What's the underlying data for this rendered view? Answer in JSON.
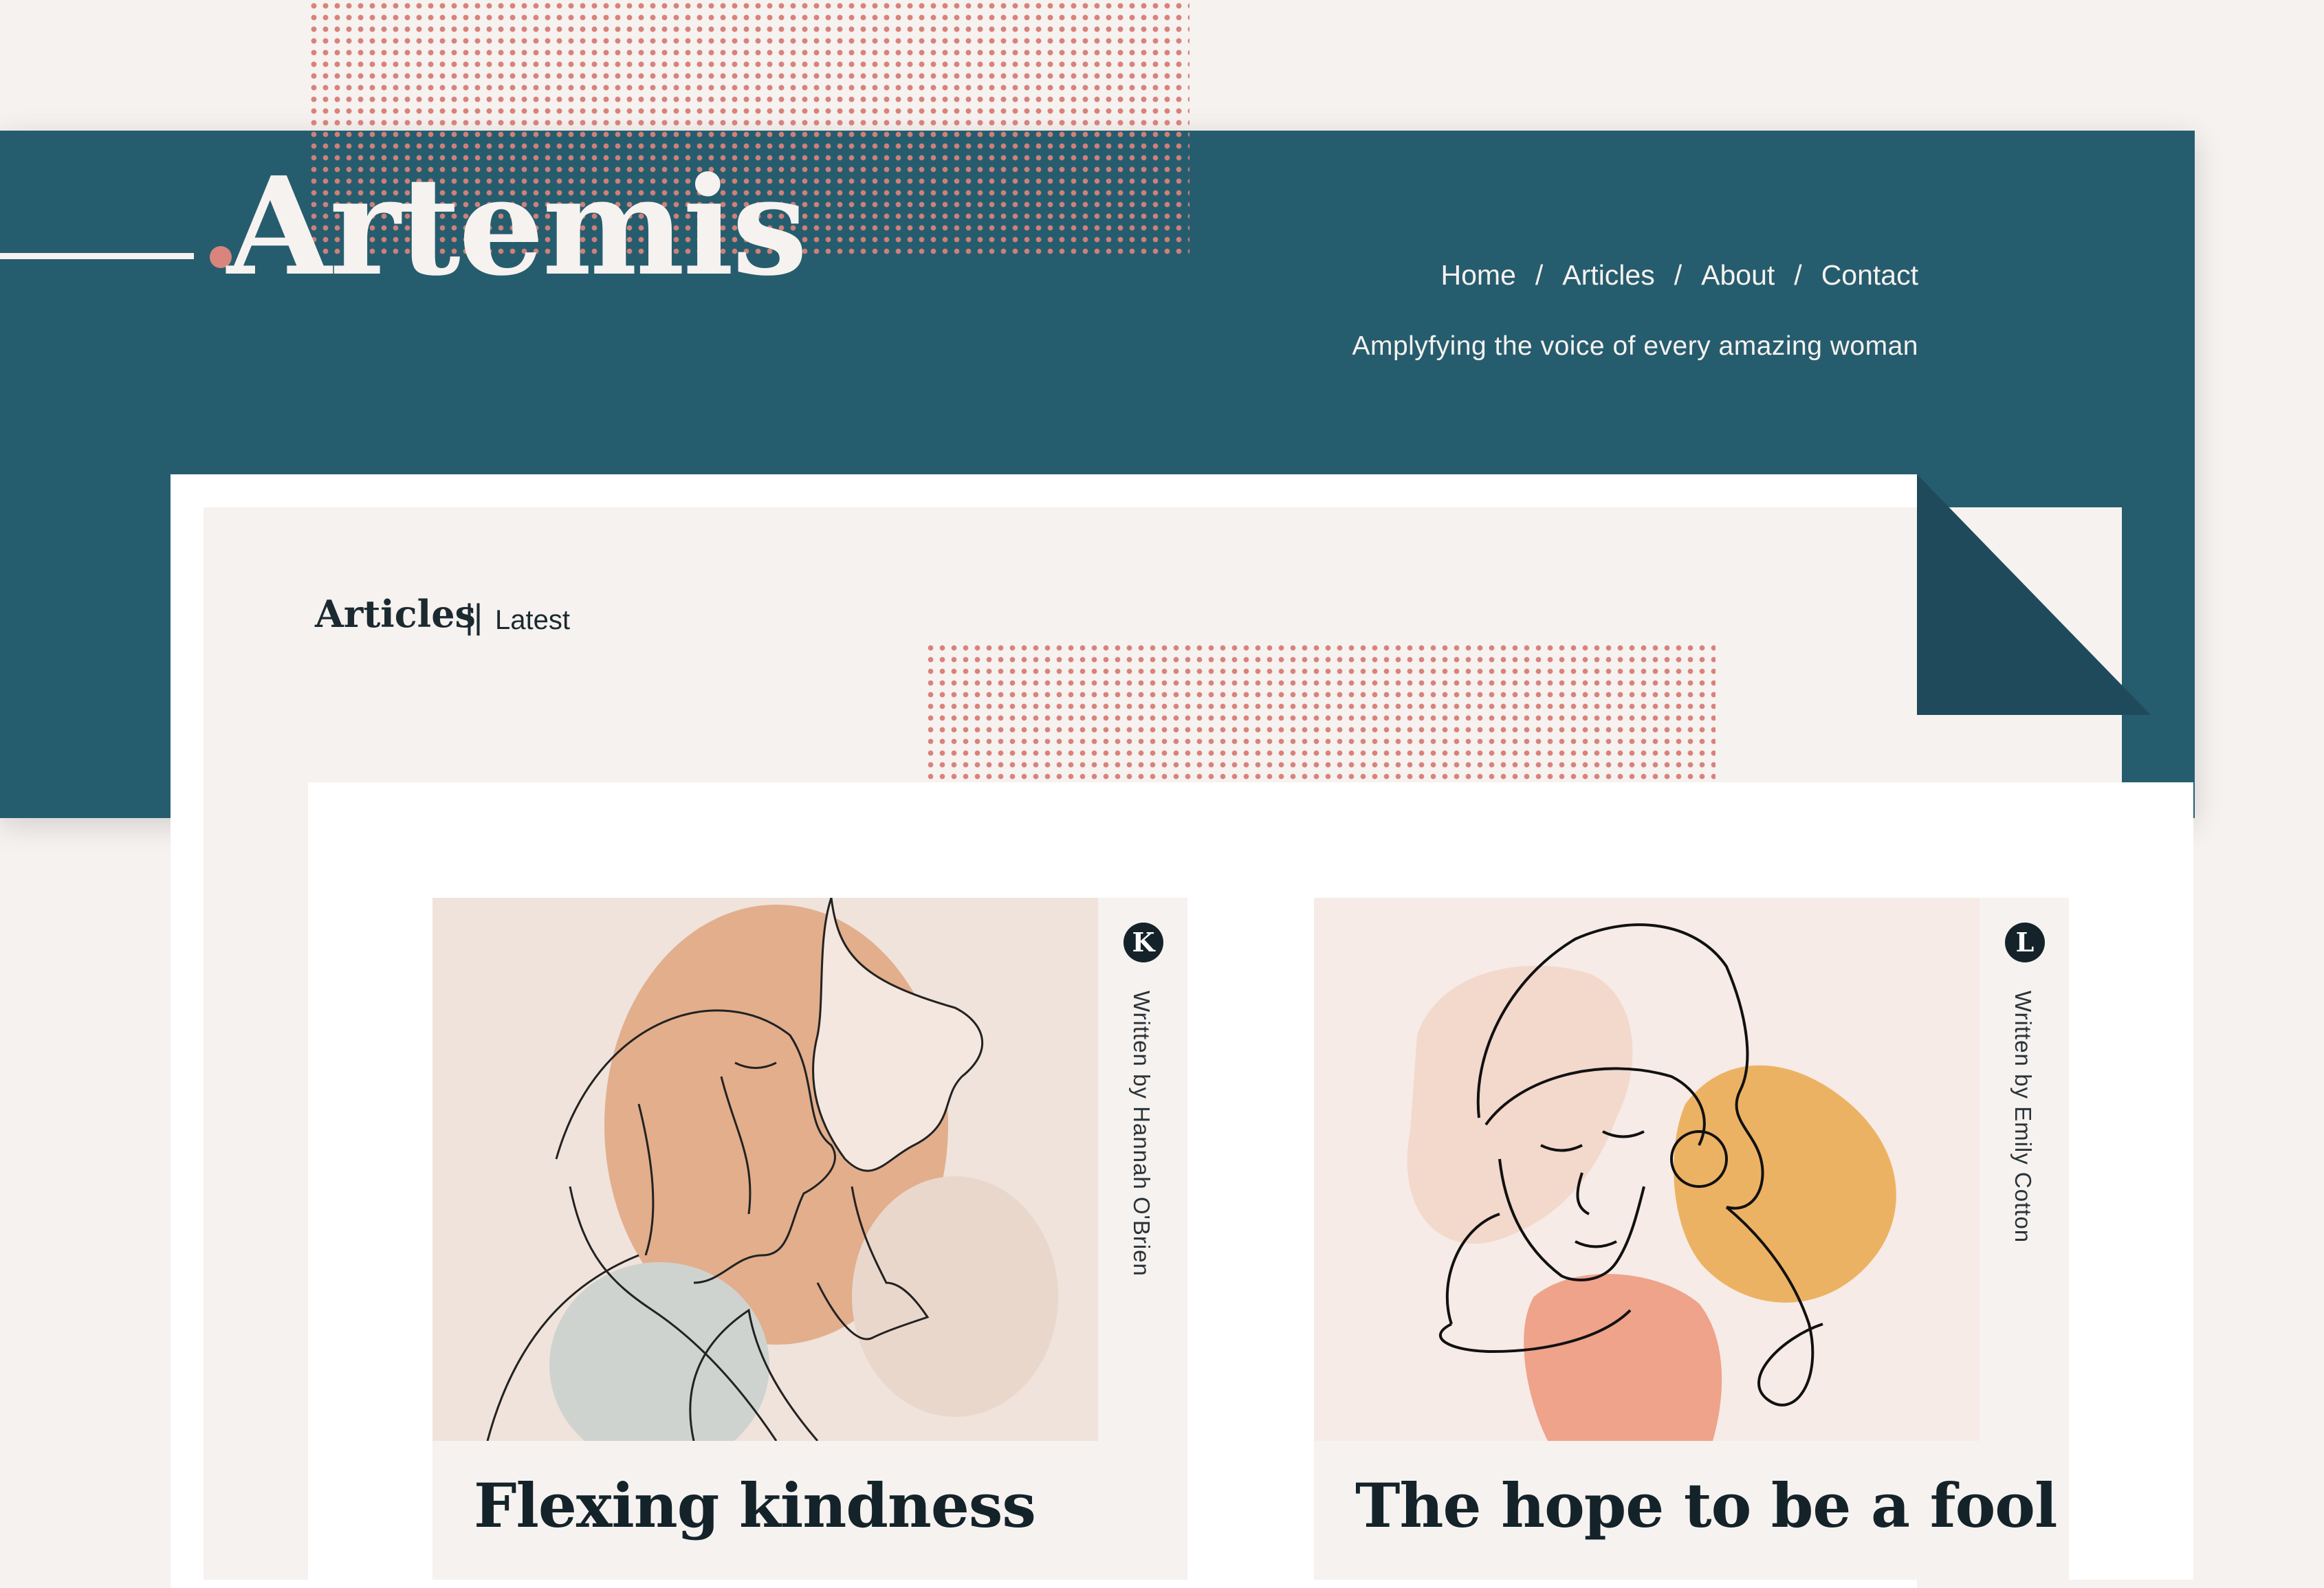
{
  "site": {
    "logo": "Artemis",
    "tagline": "Amplyfying the voice of every amazing woman",
    "nav": [
      "Home",
      "Articles",
      "About",
      "Contact"
    ],
    "nav_separator": "/"
  },
  "section": {
    "title": "Articles",
    "separator": "||",
    "subtitle": "Latest"
  },
  "articles": [
    {
      "badge": "K",
      "byline": "Written by Hannah O'Brien",
      "title": "Flexing kindness",
      "illustration": "two-women-line-art"
    },
    {
      "badge": "L",
      "byline": "Written by Emily Cotton",
      "title": "The hope to be a fool",
      "illustration": "abstract-face-line-art"
    }
  ],
  "colors": {
    "header": "#265d6e",
    "fold": "#1f4a5b",
    "background": "#f6f2f0",
    "accent_dots": "#d9827b",
    "text_dark": "#14232a"
  }
}
